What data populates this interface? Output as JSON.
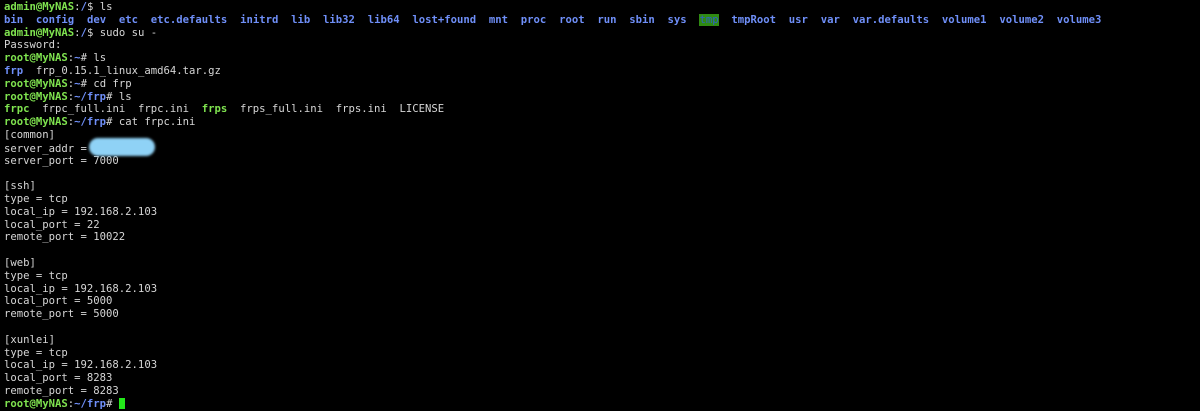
{
  "prompts": {
    "admin_home": {
      "user": "admin@MyNAS",
      "sep": ":",
      "path": "/",
      "sym": "$ "
    },
    "root_home": {
      "user": "root@MyNAS",
      "sep": ":",
      "path": "~",
      "sym": "# "
    },
    "root_frp": {
      "user": "root@MyNAS",
      "sep": ":",
      "path": "~/frp",
      "sym": "# "
    }
  },
  "lines": [
    {
      "type": "prompt",
      "prompt": "admin_home",
      "cmd": "ls"
    },
    {
      "type": "listing",
      "items": [
        {
          "name": "bin",
          "kind": "dir"
        },
        {
          "name": "config",
          "kind": "dir"
        },
        {
          "name": "dev",
          "kind": "dir"
        },
        {
          "name": "etc",
          "kind": "dir"
        },
        {
          "name": "etc.defaults",
          "kind": "dir"
        },
        {
          "name": "initrd",
          "kind": "dir"
        },
        {
          "name": "lib",
          "kind": "dir"
        },
        {
          "name": "lib32",
          "kind": "dir"
        },
        {
          "name": "lib64",
          "kind": "dir"
        },
        {
          "name": "lost+found",
          "kind": "dir"
        },
        {
          "name": "mnt",
          "kind": "dir"
        },
        {
          "name": "proc",
          "kind": "dir"
        },
        {
          "name": "root",
          "kind": "dir"
        },
        {
          "name": "run",
          "kind": "dir"
        },
        {
          "name": "sbin",
          "kind": "dir"
        },
        {
          "name": "sys",
          "kind": "dir"
        },
        {
          "name": "tmp",
          "kind": "sticky"
        },
        {
          "name": "tmpRoot",
          "kind": "dir"
        },
        {
          "name": "usr",
          "kind": "dir"
        },
        {
          "name": "var",
          "kind": "dir"
        },
        {
          "name": "var.defaults",
          "kind": "dir"
        },
        {
          "name": "volume1",
          "kind": "dir"
        },
        {
          "name": "volume2",
          "kind": "dir"
        },
        {
          "name": "volume3",
          "kind": "dir"
        }
      ]
    },
    {
      "type": "prompt",
      "prompt": "admin_home",
      "cmd": "sudo su -"
    },
    {
      "type": "text",
      "text": "Password:"
    },
    {
      "type": "prompt",
      "prompt": "root_home",
      "cmd": "ls"
    },
    {
      "type": "listing",
      "items": [
        {
          "name": "frp",
          "kind": "dir"
        },
        {
          "name": "frp_0.15.1_linux_amd64.tar.gz",
          "kind": "file"
        }
      ]
    },
    {
      "type": "prompt",
      "prompt": "root_home",
      "cmd": "cd frp"
    },
    {
      "type": "prompt",
      "prompt": "root_frp",
      "cmd": "ls"
    },
    {
      "type": "listing",
      "items": [
        {
          "name": "frpc",
          "kind": "exec"
        },
        {
          "name": "frpc_full.ini",
          "kind": "file"
        },
        {
          "name": "frpc.ini",
          "kind": "file"
        },
        {
          "name": "frps",
          "kind": "exec"
        },
        {
          "name": "frps_full.ini",
          "kind": "file"
        },
        {
          "name": "frps.ini",
          "kind": "file"
        },
        {
          "name": "LICENSE",
          "kind": "file"
        }
      ]
    },
    {
      "type": "prompt",
      "prompt": "root_frp",
      "cmd": "cat frpc.ini"
    },
    {
      "type": "text",
      "text": "[common]"
    },
    {
      "type": "redacted",
      "text": "server_addr = "
    },
    {
      "type": "text",
      "text": "server_port = 7000"
    },
    {
      "type": "text",
      "text": ""
    },
    {
      "type": "text",
      "text": "[ssh]"
    },
    {
      "type": "text",
      "text": "type = tcp"
    },
    {
      "type": "text",
      "text": "local_ip = 192.168.2.103"
    },
    {
      "type": "text",
      "text": "local_port = 22"
    },
    {
      "type": "text",
      "text": "remote_port = 10022"
    },
    {
      "type": "text",
      "text": ""
    },
    {
      "type": "text",
      "text": "[web]"
    },
    {
      "type": "text",
      "text": "type = tcp"
    },
    {
      "type": "text",
      "text": "local_ip = 192.168.2.103"
    },
    {
      "type": "text",
      "text": "local_port = 5000"
    },
    {
      "type": "text",
      "text": "remote_port = 5000"
    },
    {
      "type": "text",
      "text": ""
    },
    {
      "type": "text",
      "text": "[xunlei]"
    },
    {
      "type": "text",
      "text": "type = tcp"
    },
    {
      "type": "text",
      "text": "local_ip = 192.168.2.103"
    },
    {
      "type": "text",
      "text": "local_port = 8283"
    },
    {
      "type": "text",
      "text": "remote_port = 8283"
    },
    {
      "type": "prompt",
      "prompt": "root_frp",
      "cmd": "",
      "cursor": true
    }
  ],
  "colors": {
    "background": "#000000",
    "text": "#d6d6d6",
    "prompt_user": "#7fe34f",
    "prompt_path": "#6f8ff8",
    "directory": "#6f8ff8",
    "executable": "#7fe34f",
    "sticky_bg": "#2f8a12",
    "cursor": "#23e81a",
    "redaction": "#8fd2f6"
  }
}
